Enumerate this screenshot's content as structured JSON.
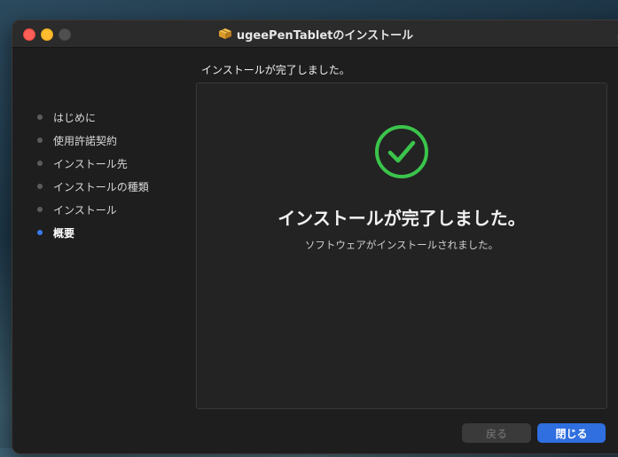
{
  "window": {
    "title": "ugeePenTabletのインストール"
  },
  "header": {
    "text": "インストールが完了しました。"
  },
  "sidebar": {
    "items": [
      {
        "label": "はじめに",
        "active": false
      },
      {
        "label": "使用許諾契約",
        "active": false
      },
      {
        "label": "インストール先",
        "active": false
      },
      {
        "label": "インストールの種類",
        "active": false
      },
      {
        "label": "インストール",
        "active": false
      },
      {
        "label": "概要",
        "active": true
      }
    ]
  },
  "main": {
    "title": "インストールが完了しました。",
    "subtitle": "ソフトウェアがインストールされました。",
    "icon": "checkmark-circle-icon"
  },
  "buttons": {
    "back_label": "戻る",
    "close_label": "閉じる"
  },
  "colors": {
    "accent": "#2f6fe0",
    "success": "#3bc44b",
    "active_step": "#3a7af0"
  }
}
